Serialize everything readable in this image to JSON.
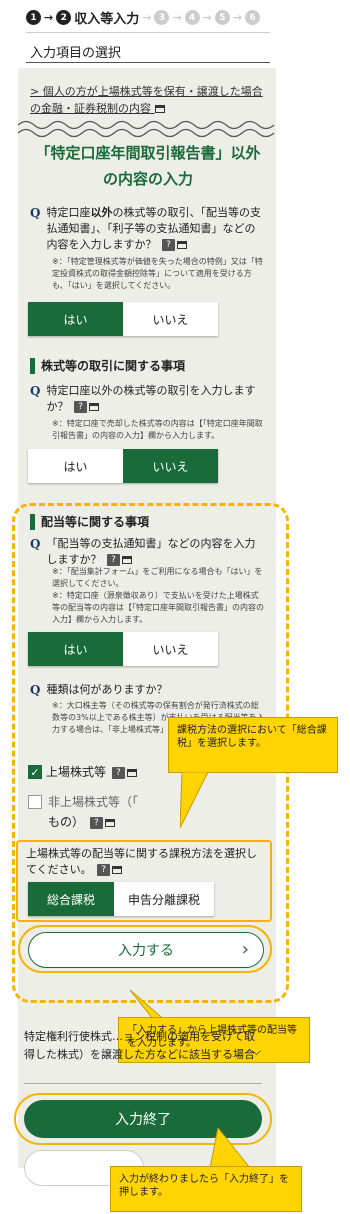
{
  "steps": {
    "s1": "1",
    "s2": "2",
    "label": "収入等入力",
    "s3": "3",
    "s4": "4",
    "s5": "5",
    "s6": "6"
  },
  "section_title": "入力項目の選択",
  "link_text": "個人の方が上場株式等を保有・譲渡した場合の金融・証券税制の内容",
  "big_title": "「特定口座年間取引報告書」以外の内容の入力",
  "q1": {
    "text_a": "特定口座",
    "text_b": "以外",
    "text_c": "の株式等の取引、「配当等の支払通知書」、「利子等の支払通知書」などの内容を入力しますか？",
    "note": "※：「特定管理株式等が価値を失った場合の特例」又は「特定投資株式の取得金額控除等」について適用を受ける方も、「はい」を選択してください。",
    "yes": "はい",
    "no": "いいえ"
  },
  "sect1": "株式等の取引に関する事項",
  "q2": {
    "text": "特定口座以外の株式等の取引を入力しますか？",
    "note": "※：特定口座で売却した株式等の内容は【「特定口座年間取引報告書」の内容の入力】欄から入力します。",
    "yes": "はい",
    "no": "いいえ"
  },
  "sect2": "配当等に関する事項",
  "q3": {
    "text": "「配当等の支払通知書」などの内容を入力しますか？",
    "note1": "※：「配当集計フォーム」をご利用になる場合も「はい」を選択してください。",
    "note2": "※：特定口座（源泉徴収あり）で支払いを受けた上場株式等の配当等の内容は【「特定口座年間取引報告書」の内容の入力】欄から入力します。",
    "yes": "はい",
    "no": "いいえ"
  },
  "q4": {
    "text": "種類は何がありますか？",
    "note": "※：大口株主等（その株式等の保有割合が発行済株式の総数等の3%以上である株主等）が支払いを受ける配当等を入力する場合は、「非上場株式等」を選択してください。"
  },
  "chk1": "上場株式等",
  "chk2a": "非上場株式等（「",
  "chk2b": "もの）",
  "tax_q": "上場株式等の配当等に関する課税方法を選択してください。",
  "tax_opt1": "総合課税",
  "tax_opt2": "申告分離課税",
  "enter_btn": "入力する",
  "chevron": "›",
  "expand_text": "特定権利行使株式…ョン税制の適用を受けて取得した株式）を譲渡した方などに該当する場合",
  "finish_btn": "入力終了",
  "callout1": "課税方法の選択において「総合課税」を選択します。",
  "callout2": "「入力する」から上場株式等の配当等を入力します。",
  "callout3": "入力が終わりましたら「入力終了」を押します。",
  "colors": {
    "accent": "#1a6b3a",
    "highlight": "#f4b400",
    "callout": "#ffd400"
  }
}
